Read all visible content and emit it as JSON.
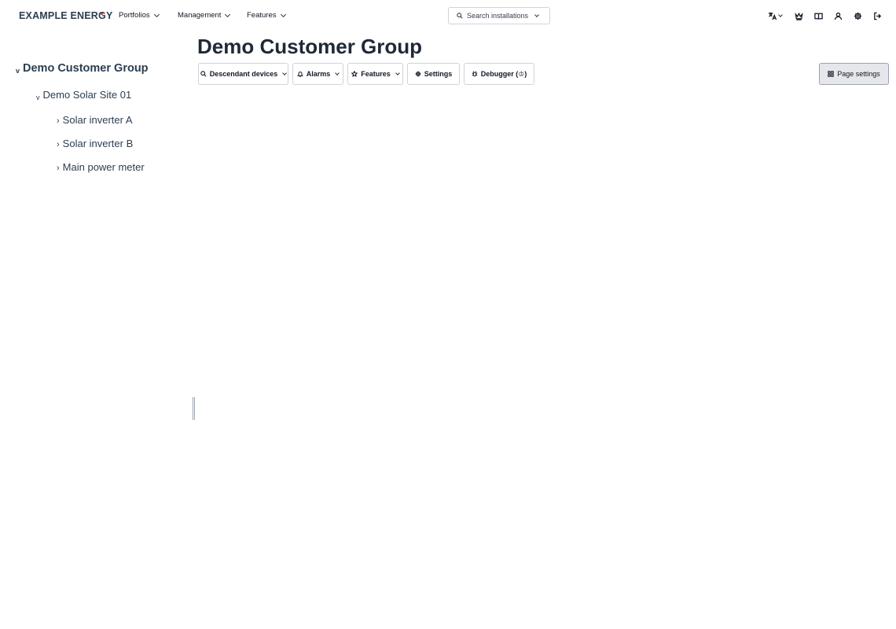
{
  "header": {
    "logo_prefix": "EXAMPLE ENER",
    "logo_o": "G",
    "logo_suffix": "Y",
    "menus": [
      {
        "label": "Portfolios"
      },
      {
        "label": "Management"
      },
      {
        "label": "Features"
      }
    ],
    "search": {
      "label": "Search installations"
    },
    "icons": [
      "translate-icon",
      "crown-icon",
      "book-icon",
      "user-icon",
      "gear-icon",
      "logout-icon"
    ]
  },
  "sidebar": {
    "root": {
      "label": "Demo Customer Group",
      "expanded": true
    },
    "site": {
      "label": "Demo Solar Site 01",
      "expanded": true
    },
    "devices": [
      {
        "label": "Solar inverter A"
      },
      {
        "label": "Solar inverter B"
      },
      {
        "label": "Main power meter"
      }
    ]
  },
  "main": {
    "title": "Demo Customer Group",
    "toolbar": {
      "descendant_devices": "Descendant devices",
      "alarms": "Alarms",
      "features": "Features",
      "settings": "Settings",
      "debugger": "Debugger (♔)",
      "page_settings": "Page settings"
    }
  },
  "colors": {
    "brand_text": "#2c3e50",
    "accent_dot": "#c0392b",
    "border": "#cfd3d8"
  }
}
